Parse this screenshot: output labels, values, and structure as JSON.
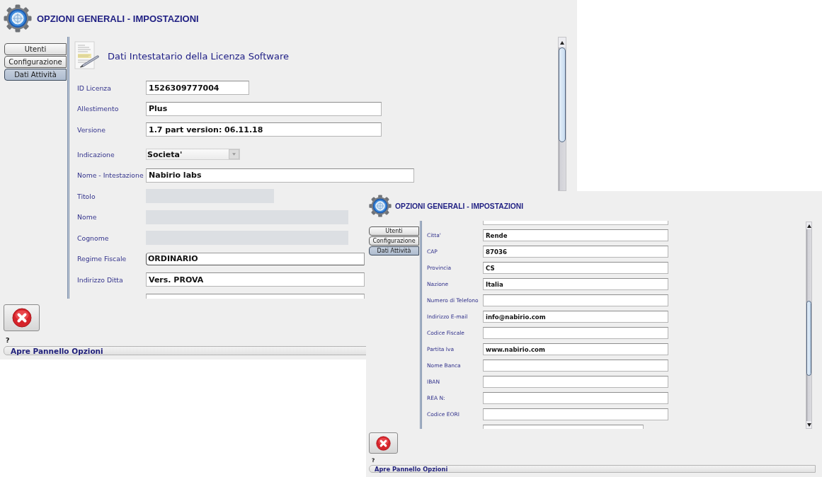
{
  "windows": [
    {
      "title": "OPZIONI GENERALI - IMPOSTAZIONI",
      "tabs": [
        {
          "label": "Utenti",
          "selected": false
        },
        {
          "label": "Configurazione",
          "selected": false
        },
        {
          "label": "Dati Attività",
          "selected": true
        }
      ],
      "heading": "Dati Intestatario della Licenza Software",
      "sections": [
        {
          "fields": [
            {
              "kind": "text",
              "label": "ID Licenza",
              "value": "1526309777004",
              "disabled": false
            },
            {
              "kind": "text",
              "label": "Allestimento",
              "value": "Plus",
              "disabled": false
            },
            {
              "kind": "text",
              "label": "Versione",
              "value": "1.7 part version: 06.11.18",
              "disabled": false
            }
          ]
        },
        {
          "fields": [
            {
              "kind": "dropdown",
              "label": "Indicazione",
              "value": "Societa'",
              "disabled": false
            },
            {
              "kind": "text",
              "label": "Nome - Intestazione",
              "value": "Nabirio labs",
              "disabled": false
            },
            {
              "kind": "text",
              "label": "Titolo",
              "disabled": true
            },
            {
              "kind": "text",
              "label": "Nome",
              "disabled": true
            },
            {
              "kind": "text",
              "label": "Cognome",
              "disabled": true
            },
            {
              "kind": "select",
              "label": "Regime Fiscale",
              "value": "ORDINARIO",
              "disabled": false
            },
            {
              "kind": "text",
              "label": "Indirizzo Ditta",
              "value": "Vers. PROVA",
              "disabled": false
            },
            {
              "kind": "partial",
              "disabled": false
            }
          ]
        }
      ],
      "help_mark": "?",
      "status_bar": "Apre Pannello Opzioni"
    },
    {
      "title": "OPZIONI GENERALI - IMPOSTAZIONI",
      "tabs": [
        {
          "label": "Utenti",
          "selected": false
        },
        {
          "label": "Configurazione",
          "selected": false
        },
        {
          "label": "Dati Attività",
          "selected": true
        }
      ],
      "sections": [
        {
          "fields": [
            {
              "kind": "partial",
              "disabled": false
            },
            {
              "kind": "text",
              "label": "Citta'",
              "value": "Rende",
              "disabled": false
            },
            {
              "kind": "text",
              "label": "CAP",
              "value": "87036",
              "disabled": false
            },
            {
              "kind": "text",
              "label": "Provincia",
              "value": "CS",
              "disabled": false
            },
            {
              "kind": "text",
              "label": "Nazione",
              "value": "Italia",
              "disabled": false
            },
            {
              "kind": "text",
              "label": "Numero di Telefono",
              "disabled": false
            },
            {
              "kind": "text",
              "label": "Indirizzo E-mail",
              "value": "info@nabirio.com",
              "disabled": false
            },
            {
              "kind": "text",
              "label": "Codice Fiscale",
              "disabled": false
            },
            {
              "kind": "text",
              "label": "Partita Iva",
              "value": "www.nabirio.com",
              "disabled": false
            },
            {
              "kind": "text",
              "label": "Nome Banca",
              "disabled": false
            },
            {
              "kind": "text",
              "label": "IBAN",
              "disabled": false
            },
            {
              "kind": "text",
              "label": "REA N:",
              "disabled": false
            },
            {
              "kind": "text",
              "label": "Codice EORI",
              "disabled": false
            },
            {
              "kind": "partial",
              "disabled": false
            }
          ]
        }
      ],
      "help_mark": "?",
      "status_bar": "Apre Pannello Opzioni"
    }
  ]
}
